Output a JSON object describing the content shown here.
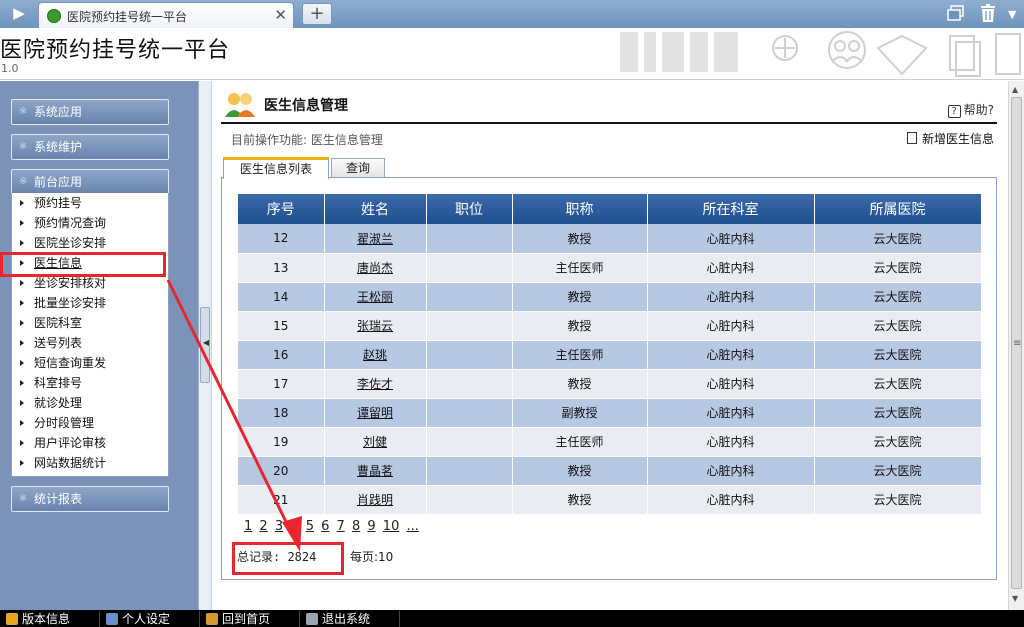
{
  "browser": {
    "tab_title": "医院预约挂号统一平台",
    "new_tab_label": "+",
    "close_label": "✕"
  },
  "app": {
    "title": "医院预约挂号统一平台",
    "version": "1.0"
  },
  "sidebar": {
    "menus": [
      "系统应用",
      "系统维护",
      "前台应用",
      "统计报表"
    ],
    "frontend_items": [
      "预约挂号",
      "预约情况查询",
      "医院坐诊安排",
      "医生信息",
      "坐诊安排核对",
      "批量坐诊安排",
      "医院科室",
      "送号列表",
      "短信查询重发",
      "科室排号",
      "就诊处理",
      "分时段管理",
      "用户评论审核",
      "网站数据统计"
    ],
    "active_item": "医生信息"
  },
  "panel": {
    "title": "医生信息管理",
    "help": "帮助?",
    "current_op": "目前操作功能: 医生信息管理",
    "add_link": "新增医生信息",
    "tabs": [
      "医生信息列表",
      "查询"
    ]
  },
  "table": {
    "headers": [
      "序号",
      "姓名",
      "职位",
      "职称",
      "所在科室",
      "所属医院"
    ],
    "rows": [
      [
        "12",
        "翟淑兰",
        "",
        "教授",
        "心脏内科",
        "云大医院"
      ],
      [
        "13",
        "唐尚杰",
        "",
        "主任医师",
        "心脏内科",
        "云大医院"
      ],
      [
        "14",
        "王松丽",
        "",
        "教授",
        "心脏内科",
        "云大医院"
      ],
      [
        "15",
        "张瑞云",
        "",
        "教授",
        "心脏内科",
        "云大医院"
      ],
      [
        "16",
        "赵珧",
        "",
        "主任医师",
        "心脏内科",
        "云大医院"
      ],
      [
        "17",
        "李佐才",
        "",
        "教授",
        "心脏内科",
        "云大医院"
      ],
      [
        "18",
        "谭留明",
        "",
        "副教授",
        "心脏内科",
        "云大医院"
      ],
      [
        "19",
        "刘健",
        "",
        "主任医师",
        "心脏内科",
        "云大医院"
      ],
      [
        "20",
        "曹晶茗",
        "",
        "教授",
        "心脏内科",
        "云大医院"
      ],
      [
        "21",
        "肖践明",
        "",
        "教授",
        "心脏内科",
        "云大医院"
      ]
    ]
  },
  "pager": {
    "pages": [
      "1",
      "2",
      "3",
      "4",
      "5",
      "6",
      "7",
      "8",
      "9",
      "10",
      "..."
    ],
    "total_label": "总记录: 2824",
    "per_page_label": "每页:10"
  },
  "taskbar": {
    "items": [
      "版本信息",
      "个人设定",
      "回到首页",
      "退出系统"
    ]
  },
  "colors": {
    "header_blue": "#2a5896",
    "row_odd": "#b7c8e3",
    "row_even": "#e9edf3",
    "annotation_red": "#e8262f",
    "sidebar_bg": "#7b93b8"
  }
}
